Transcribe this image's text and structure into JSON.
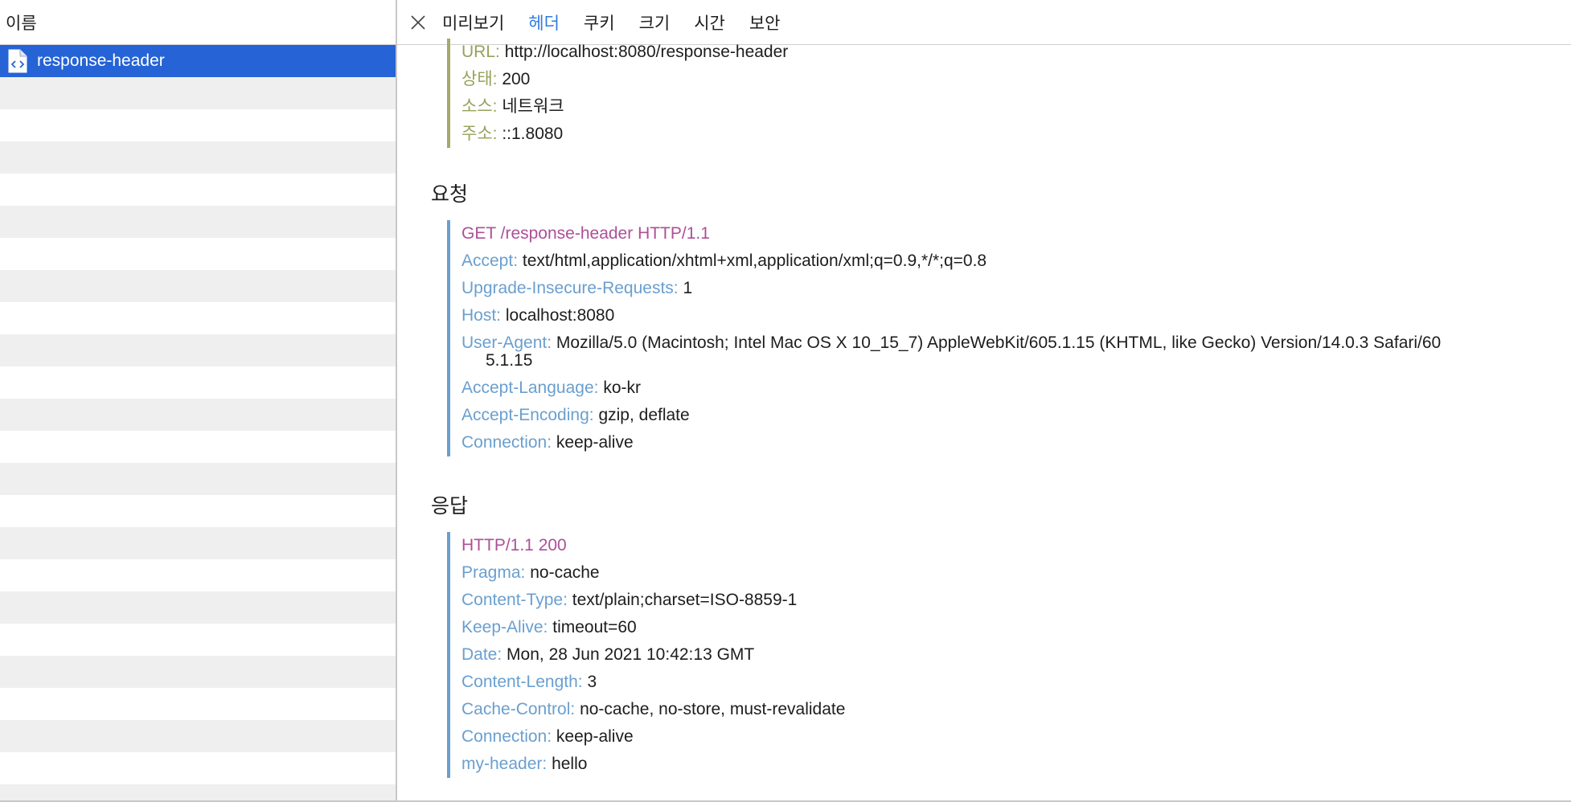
{
  "list": {
    "column_header": "이름",
    "selected_item": "response-header"
  },
  "tabs": [
    {
      "label": "미리보기",
      "active": false
    },
    {
      "label": "헤더",
      "active": true
    },
    {
      "label": "쿠키",
      "active": false
    },
    {
      "label": "크기",
      "active": false
    },
    {
      "label": "시간",
      "active": false
    },
    {
      "label": "보안",
      "active": false
    }
  ],
  "summary": {
    "url_key": "URL:",
    "url_value": "http://localhost:8080/response-header",
    "status_key": "상태:",
    "status_value": "200",
    "source_key": "소스:",
    "source_value": "네트워크",
    "address_key": "주소:",
    "address_value": "::1.8080"
  },
  "request": {
    "title": "요청",
    "request_line": "GET /response-header HTTP/1.1",
    "headers": [
      {
        "key": "Accept:",
        "value": "text/html,application/xhtml+xml,application/xml;q=0.9,*/*;q=0.8"
      },
      {
        "key": "Upgrade-Insecure-Requests:",
        "value": "1"
      },
      {
        "key": "Host:",
        "value": "localhost:8080"
      },
      {
        "key": "User-Agent:",
        "value": "Mozilla/5.0 (Macintosh; Intel Mac OS X 10_15_7) AppleWebKit/605.1.15 (KHTML, like Gecko) Version/14.0.3 Safari/60",
        "value_cont": "5.1.15"
      },
      {
        "key": "Accept-Language:",
        "value": "ko-kr"
      },
      {
        "key": "Accept-Encoding:",
        "value": "gzip, deflate"
      },
      {
        "key": "Connection:",
        "value": "keep-alive"
      }
    ]
  },
  "response": {
    "title": "응답",
    "status_line": "HTTP/1.1 200",
    "headers": [
      {
        "key": "Pragma:",
        "value": "no-cache"
      },
      {
        "key": "Content-Type:",
        "value": "text/plain;charset=ISO-8859-1"
      },
      {
        "key": "Keep-Alive:",
        "value": "timeout=60"
      },
      {
        "key": "Date:",
        "value": "Mon, 28 Jun 2021 10:42:13 GMT"
      },
      {
        "key": "Content-Length:",
        "value": "3"
      },
      {
        "key": "Cache-Control:",
        "value": "no-cache, no-store, must-revalidate"
      },
      {
        "key": "Connection:",
        "value": "keep-alive"
      },
      {
        "key": "my-header:",
        "value": "hello"
      }
    ]
  },
  "colors": {
    "selection": "#2563d6",
    "active_tab": "#2f7ae5",
    "summary_key": "#98a05b",
    "header_key": "#6a9fcf",
    "request_line": "#ae4f98"
  }
}
